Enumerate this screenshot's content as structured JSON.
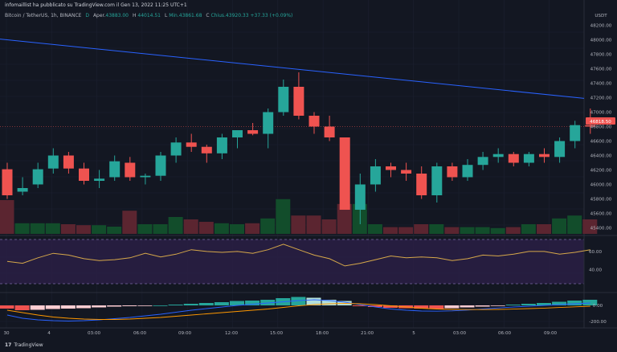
{
  "header": {
    "published_by": "infomaillist ha pubblicato su TradingView.com il Gen 13, 2022 11:25 UTC+1"
  },
  "symbol_bar": {
    "symbol": "Bitcoin / TetherUS, 1h, BINANCE",
    "status_letter": "D",
    "open_label": "Aper.",
    "open_value": "43883.00",
    "high_label": "H",
    "high_value": "44014.51",
    "low_label": "L",
    "low_value": "Min.43861.68",
    "close_label": "C",
    "close_value": "Chius.43920.33",
    "change": "+37.33 (+0.09%)"
  },
  "price_axis": {
    "currency": "USDT",
    "labels": [
      "48200.00",
      "48000.00",
      "47800.00",
      "47600.00",
      "47400.00",
      "47200.00",
      "47000.00",
      "46800.00",
      "46600.00",
      "46400.00",
      "46200.00",
      "46000.00",
      "45800.00",
      "45600.00",
      "45400.00"
    ],
    "current_price": "46818.50"
  },
  "rsi_axis": {
    "labels": [
      "60.00",
      "40.00"
    ]
  },
  "macd_axis": {
    "labels": [
      "0.00",
      "-200.00"
    ]
  },
  "time_axis": {
    "labels": [
      "30",
      "4",
      "03:00",
      "06:00",
      "09:00",
      "12:00",
      "15:00",
      "18:00",
      "21:00",
      "5",
      "03:00",
      "06:00",
      "09:00"
    ]
  },
  "footer": {
    "logo_mark": "17",
    "brand": "TradingView"
  },
  "colors": {
    "background": "#131722",
    "bull": "#26a69a",
    "bear": "#ef5350",
    "ma_line": "#2962ff",
    "rsi_line": "#d6a84a",
    "rsi_band": "#2a1f44",
    "macd_line": "#2962ff",
    "signal_line": "#ff9800"
  },
  "chart_data": {
    "type": "candlestick",
    "candles": [
      {
        "o": 46210,
        "h": 46300,
        "l": 45800,
        "c": 45850
      },
      {
        "o": 45900,
        "h": 46100,
        "l": 45850,
        "c": 45950
      },
      {
        "o": 46000,
        "h": 46300,
        "l": 45950,
        "c": 46210
      },
      {
        "o": 46220,
        "h": 46500,
        "l": 46150,
        "c": 46400
      },
      {
        "o": 46400,
        "h": 46450,
        "l": 46150,
        "c": 46220
      },
      {
        "o": 46220,
        "h": 46300,
        "l": 46000,
        "c": 46050
      },
      {
        "o": 46050,
        "h": 46200,
        "l": 45950,
        "c": 46080
      },
      {
        "o": 46100,
        "h": 46400,
        "l": 46050,
        "c": 46320
      },
      {
        "o": 46300,
        "h": 46380,
        "l": 46050,
        "c": 46100
      },
      {
        "o": 46100,
        "h": 46150,
        "l": 46000,
        "c": 46120
      },
      {
        "o": 46120,
        "h": 46450,
        "l": 46050,
        "c": 46400
      },
      {
        "o": 46400,
        "h": 46650,
        "l": 46300,
        "c": 46580
      },
      {
        "o": 46580,
        "h": 46700,
        "l": 46450,
        "c": 46520
      },
      {
        "o": 46520,
        "h": 46550,
        "l": 46300,
        "c": 46430
      },
      {
        "o": 46430,
        "h": 46700,
        "l": 46350,
        "c": 46650
      },
      {
        "o": 46650,
        "h": 46750,
        "l": 46500,
        "c": 46750
      },
      {
        "o": 46750,
        "h": 46850,
        "l": 46680,
        "c": 46700
      },
      {
        "o": 46700,
        "h": 47050,
        "l": 46500,
        "c": 47000
      },
      {
        "o": 47000,
        "h": 47450,
        "l": 46950,
        "c": 47350
      },
      {
        "o": 47350,
        "h": 47550,
        "l": 46900,
        "c": 46950
      },
      {
        "o": 46950,
        "h": 47000,
        "l": 46700,
        "c": 46800
      },
      {
        "o": 46800,
        "h": 46950,
        "l": 46600,
        "c": 46650
      },
      {
        "o": 46650,
        "h": 46650,
        "l": 45700,
        "c": 45650
      },
      {
        "o": 45650,
        "h": 46150,
        "l": 45450,
        "c": 46000
      },
      {
        "o": 46000,
        "h": 46350,
        "l": 45900,
        "c": 46250
      },
      {
        "o": 46250,
        "h": 46300,
        "l": 46100,
        "c": 46200
      },
      {
        "o": 46200,
        "h": 46300,
        "l": 46050,
        "c": 46150
      },
      {
        "o": 46150,
        "h": 46250,
        "l": 45800,
        "c": 45850
      },
      {
        "o": 45850,
        "h": 46300,
        "l": 45750,
        "c": 46250
      },
      {
        "o": 46250,
        "h": 46300,
        "l": 46050,
        "c": 46100
      },
      {
        "o": 46100,
        "h": 46350,
        "l": 46050,
        "c": 46270
      },
      {
        "o": 46270,
        "h": 46450,
        "l": 46200,
        "c": 46380
      },
      {
        "o": 46380,
        "h": 46500,
        "l": 46300,
        "c": 46420
      },
      {
        "o": 46420,
        "h": 46450,
        "l": 46250,
        "c": 46300
      },
      {
        "o": 46300,
        "h": 46450,
        "l": 46250,
        "c": 46420
      },
      {
        "o": 46420,
        "h": 46500,
        "l": 46300,
        "c": 46380
      },
      {
        "o": 46380,
        "h": 46650,
        "l": 46300,
        "c": 46600
      },
      {
        "o": 46600,
        "h": 46880,
        "l": 46500,
        "c": 46820
      },
      {
        "o": 46820,
        "h": 47050,
        "l": 46700,
        "c": 46800
      }
    ],
    "volume": [
      0.7,
      0.22,
      0.22,
      0.22,
      0.2,
      0.18,
      0.18,
      0.15,
      0.48,
      0.2,
      0.2,
      0.35,
      0.3,
      0.25,
      0.22,
      0.2,
      0.22,
      0.32,
      0.72,
      0.38,
      0.38,
      0.3,
      0.62,
      0.62,
      0.2,
      0.14,
      0.14,
      0.2,
      0.2,
      0.14,
      0.14,
      0.14,
      0.12,
      0.14,
      0.2,
      0.2,
      0.32,
      0.38,
      0.3
    ],
    "moving_average": {
      "start": 48010,
      "end": 47190
    },
    "rsi": [
      49,
      47,
      53,
      58,
      56,
      52,
      50,
      51,
      53,
      58,
      54,
      57,
      62,
      60,
      59,
      60,
      58,
      62,
      68,
      62,
      56,
      52,
      44,
      47,
      51,
      55,
      53,
      54,
      53,
      50,
      52,
      56,
      55,
      57,
      60,
      60,
      57,
      59,
      62
    ],
    "macd_histogram": [
      -40,
      -60,
      -55,
      -45,
      -40,
      -35,
      -25,
      -15,
      -10,
      -5,
      0,
      10,
      20,
      30,
      40,
      55,
      60,
      70,
      90,
      105,
      95,
      70,
      55,
      -10,
      -20,
      -30,
      -35,
      -40,
      -45,
      -35,
      -25,
      -15,
      -5,
      10,
      20,
      30,
      45,
      60,
      70
    ],
    "macd_line": [
      -120,
      -160,
      -180,
      -190,
      -195,
      -190,
      -180,
      -165,
      -150,
      -130,
      -110,
      -85,
      -60,
      -40,
      -20,
      0,
      15,
      30,
      45,
      60,
      70,
      60,
      40,
      10,
      -20,
      -45,
      -60,
      -70,
      -72,
      -68,
      -58,
      -45,
      -32,
      -20,
      -10,
      0,
      10,
      20,
      30
    ],
    "signal_line": [
      -60,
      -90,
      -120,
      -145,
      -160,
      -170,
      -175,
      -175,
      -170,
      -160,
      -150,
      -135,
      -120,
      -105,
      -90,
      -75,
      -60,
      -45,
      -25,
      -5,
      10,
      20,
      25,
      20,
      10,
      -5,
      -20,
      -35,
      -45,
      -50,
      -52,
      -52,
      -50,
      -46,
      -40,
      -34,
      -26,
      -18,
      -10
    ],
    "price_range": [
      45350,
      48250
    ],
    "rsi_range": [
      20,
      75
    ],
    "macd_range": [
      -260,
      140
    ]
  }
}
